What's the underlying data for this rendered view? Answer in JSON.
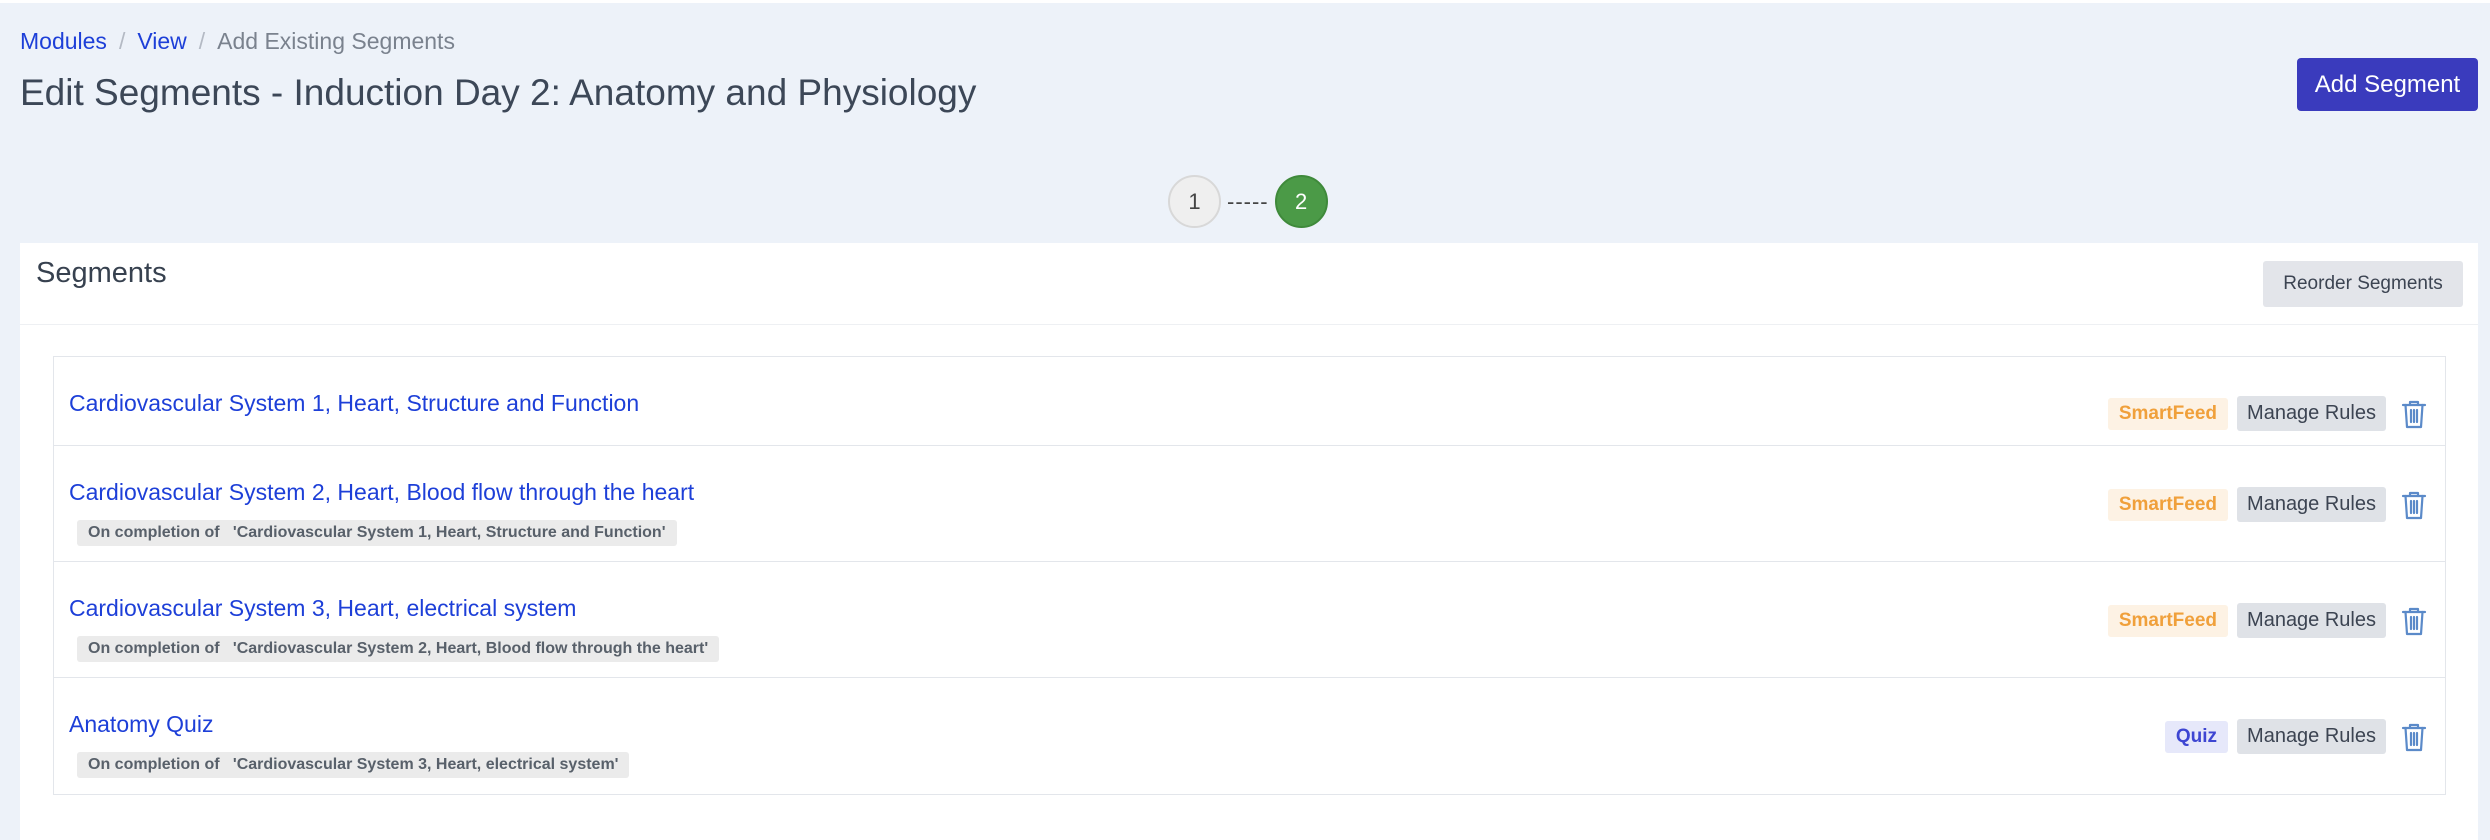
{
  "breadcrumb": {
    "items": [
      "Modules",
      "View"
    ],
    "separator": "/",
    "current": "Add Existing Segments"
  },
  "page_title": "Edit Segments - Induction Day 2: Anatomy and Physiology",
  "add_segment_label": "Add Segment",
  "stepper": {
    "steps": [
      "1",
      "2"
    ],
    "connector": "-----",
    "active_step": "2"
  },
  "card": {
    "title": "Segments",
    "reorder_label": "Reorder Segments"
  },
  "manage_rules_label": "Manage Rules",
  "segments": [
    {
      "title": "Cardiovascular System 1, Heart, Structure and Function",
      "condition": "",
      "type_label": "SmartFeed",
      "type": "smartfeed"
    },
    {
      "title": "Cardiovascular System 2, Heart, Blood flow through the heart",
      "condition": "On completion of   'Cardiovascular System 1, Heart, Structure and Function'",
      "type_label": "SmartFeed",
      "type": "smartfeed"
    },
    {
      "title": "Cardiovascular System 3, Heart, electrical system",
      "condition": "On completion of   'Cardiovascular System 2, Heart, Blood flow through the heart'",
      "type_label": "SmartFeed",
      "type": "smartfeed"
    },
    {
      "title": "Anatomy Quiz",
      "condition": "On completion of   'Cardiovascular System 3, Heart, electrical system'",
      "type_label": "Quiz",
      "type": "quiz"
    }
  ],
  "icons": {
    "delete": "trash-icon"
  },
  "colors": {
    "link": "#1d3fd8",
    "primary_button": "#3a3bbd",
    "active_step": "#4b9a47",
    "smartfeed_text": "#f0a03b",
    "quiz_text": "#3e46d2",
    "trash_icon": "#5b8ac9"
  }
}
